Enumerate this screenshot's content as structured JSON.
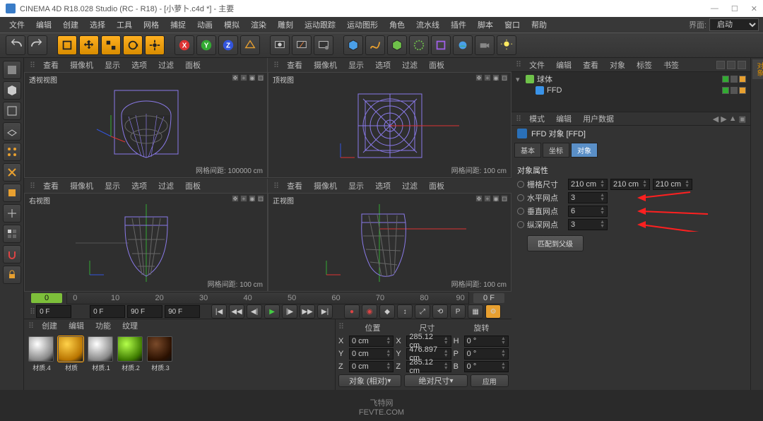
{
  "title": "CINEMA 4D R18.028 Studio (RC - R18) - [小萝卜.c4d *] - 主要",
  "menus": [
    "文件",
    "编辑",
    "创建",
    "选择",
    "工具",
    "网格",
    "捕捉",
    "动画",
    "模拟",
    "渲染",
    "雕刻",
    "运动跟踪",
    "运动图形",
    "角色",
    "流水线",
    "插件",
    "脚本",
    "窗口",
    "帮助"
  ],
  "layout_label": "界面:",
  "layout_value": "启动",
  "view_menu": [
    "查看",
    "摄像机",
    "显示",
    "选项",
    "过滤",
    "面板"
  ],
  "viewports": {
    "tl": {
      "label": "透视视图",
      "status": "网格间距: 100000 cm"
    },
    "tr": {
      "label": "顶视图",
      "status": "网格间距: 100 cm"
    },
    "bl": {
      "label": "右视图",
      "status": "网格间距: 100 cm"
    },
    "br": {
      "label": "正视图",
      "status": "网格间距: 100 cm"
    }
  },
  "timeline": {
    "start": "0",
    "end": "90",
    "cur_l": "0 F",
    "cur_r": "0 F",
    "frames": [
      "0",
      "10",
      "20",
      "30",
      "40",
      "50",
      "60",
      "70",
      "80",
      "90"
    ]
  },
  "playback": {
    "startF": "0 F",
    "prevF": "0 F",
    "nextF": "90 F",
    "endF": "90 F"
  },
  "materials": {
    "tabs": [
      "创建",
      "编辑",
      "功能",
      "纹理"
    ],
    "items": [
      {
        "name": "材质.4",
        "c1": "#fff",
        "c2": "#888"
      },
      {
        "name": "材质",
        "c1": "#ffd24a",
        "c2": "#b87400"
      },
      {
        "name": "材质.1",
        "c1": "#fff",
        "c2": "#888"
      },
      {
        "name": "材质.2",
        "c1": "#b4ff4a",
        "c2": "#3d7a00"
      },
      {
        "name": "材质.3",
        "c1": "#7a4a2a",
        "c2": "#2a1000"
      }
    ],
    "sel": 1
  },
  "coords": {
    "headers": [
      "位置",
      "尺寸",
      "旋转"
    ],
    "rows": [
      {
        "axis": "X",
        "p": "0 cm",
        "s": "285.12 cm",
        "rl": "H",
        "r": "0 °"
      },
      {
        "axis": "Y",
        "p": "0 cm",
        "s": "476.897 cm",
        "rl": "P",
        "r": "0 °"
      },
      {
        "axis": "Z",
        "p": "0 cm",
        "s": "285.12 cm",
        "rl": "B",
        "r": "0 °"
      }
    ],
    "mode1": "对象 (相对)",
    "mode2": "绝对尺寸",
    "apply": "应用"
  },
  "objects": {
    "tabs": [
      "文件",
      "编辑",
      "查看",
      "对象",
      "标签",
      "书签"
    ],
    "tree": [
      {
        "indent": 0,
        "exp": "▾",
        "ico": "#6fc24a",
        "name": "球体"
      },
      {
        "indent": 1,
        "exp": "",
        "ico": "#3a93e8",
        "name": "FFD"
      }
    ]
  },
  "attrs": {
    "tabs": [
      "模式",
      "编辑",
      "用户数据"
    ],
    "title": "FFD 对象 [FFD]",
    "subtabs": [
      "基本",
      "坐标",
      "对象"
    ],
    "active_subtab": 2,
    "section_title": "对象属性",
    "grid_size_label": "栅格尺寸",
    "grid_size": [
      "210 cm",
      "210 cm",
      "210 cm"
    ],
    "rows": [
      {
        "label": "水平网点",
        "value": "3"
      },
      {
        "label": "垂直网点",
        "value": "6"
      },
      {
        "label": "纵深网点",
        "value": "3"
      }
    ],
    "fit_btn": "匹配到父级"
  },
  "watermark1": "飞特网",
  "watermark2": "FEVTE.COM"
}
